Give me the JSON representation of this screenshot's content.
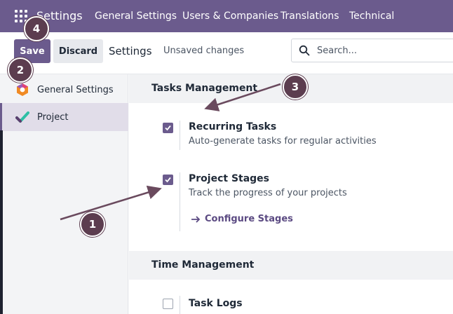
{
  "topbar": {
    "app_name": "Settings",
    "menu": [
      "General Settings",
      "Users & Companies",
      "Translations",
      "Technical"
    ]
  },
  "controls": {
    "save_label": "Save",
    "discard_label": "Discard",
    "title": "Settings",
    "status": "Unsaved changes",
    "search_placeholder": "Search..."
  },
  "sidebar": {
    "items": [
      {
        "label": "General Settings",
        "icon": "odoo-hexagon-icon",
        "active": false
      },
      {
        "label": "Project",
        "icon": "project-check-icon",
        "active": true
      }
    ]
  },
  "sections": [
    {
      "title": "Tasks Management",
      "settings": [
        {
          "title": "Recurring Tasks",
          "description": "Auto-generate tasks for regular activities",
          "checked": true
        },
        {
          "title": "Project Stages",
          "description": "Track the progress of your projects",
          "checked": true,
          "link": "Configure Stages"
        }
      ]
    },
    {
      "title": "Time Management",
      "settings": [
        {
          "title": "Task Logs",
          "checked": false
        }
      ]
    }
  ],
  "annotations": [
    "1",
    "2",
    "3",
    "4"
  ],
  "colors": {
    "brand": "#6b5b8d",
    "annotation": "#5c3d4f",
    "link": "#5b4a82"
  }
}
